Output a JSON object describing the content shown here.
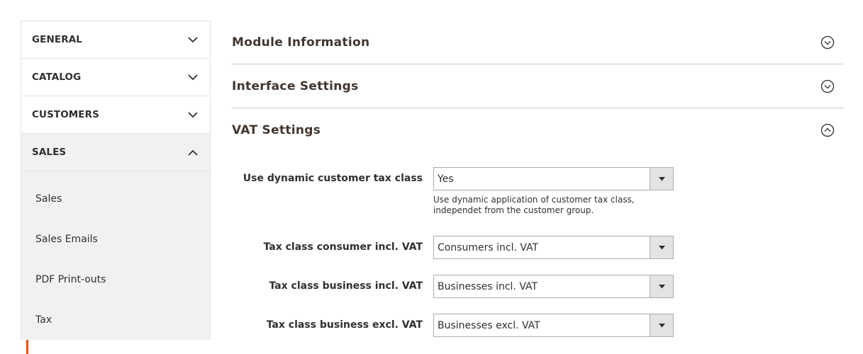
{
  "sidebar": {
    "items": [
      {
        "label": "GENERAL",
        "state": "collapsed"
      },
      {
        "label": "CATALOG",
        "state": "collapsed"
      },
      {
        "label": "CUSTOMERS",
        "state": "collapsed"
      },
      {
        "label": "SALES",
        "state": "expanded"
      }
    ],
    "sub_items": [
      "Sales",
      "Sales Emails",
      "PDF Print-outs",
      "Tax"
    ],
    "accent_color": "#eb5202"
  },
  "sections": [
    {
      "title": "Module Information",
      "state": "collapsed"
    },
    {
      "title": "Interface Settings",
      "state": "collapsed"
    },
    {
      "title": "VAT Settings",
      "state": "expanded"
    }
  ],
  "vat_fields": [
    {
      "label": "Use dynamic customer tax class",
      "value": "Yes",
      "note": "Use dynamic application of customer tax class, independet from the customer group."
    },
    {
      "label": "Tax class consumer incl. VAT",
      "value": "Consumers incl. VAT"
    },
    {
      "label": "Tax class business incl. VAT",
      "value": "Businesses incl. VAT"
    },
    {
      "label": "Tax class business excl. VAT",
      "value": "Businesses excl. VAT"
    }
  ]
}
